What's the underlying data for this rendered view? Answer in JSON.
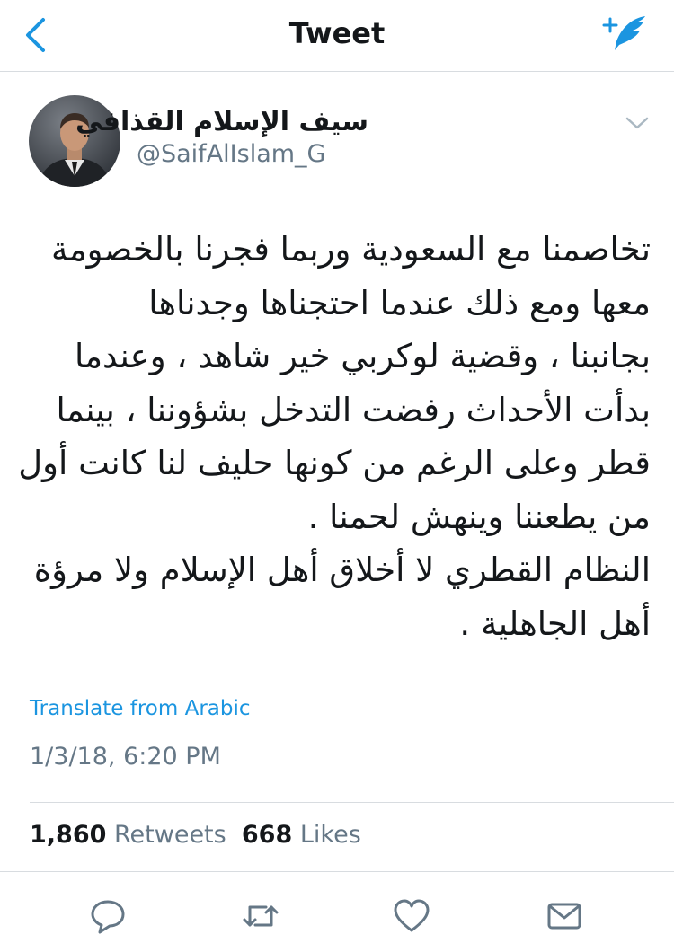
{
  "nav": {
    "title": "Tweet"
  },
  "author": {
    "display_name": "سيف الإسلام القذافي",
    "handle": "@SaifAlIslam_G"
  },
  "tweet": {
    "lines": [
      "تخاصمنا مع السعودية وربما فجرنا بالخصومة",
      "معها ومع ذلك عندما احتجناها وجدناها",
      "بجانبنا ، وقضية لوكربي خير شاهد ، وعندما",
      "بدأت الأحداث رفضت التدخل بشؤوننا ، بينما",
      "قطر وعلى الرغم من كونها حليف لنا كانت أول",
      "من يطعننا وينهش لحمنا .",
      "النظام القطري لا أخلاق أهل الإسلام ولا مرؤة",
      "أهل الجاهلية ."
    ],
    "translate_label": "Translate from Arabic",
    "timestamp": "1/3/18, 6:20 PM"
  },
  "stats": {
    "retweets_count": "1,860",
    "retweets_label": "Retweets",
    "likes_count": "668",
    "likes_label": "Likes"
  },
  "actions": [
    "reply-icon",
    "retweet-icon",
    "like-icon",
    "share-icon"
  ],
  "colors": {
    "accent": "#1b95e0",
    "icon_gray": "#657786",
    "text": "#14171a",
    "divider": "#d8dce0"
  }
}
